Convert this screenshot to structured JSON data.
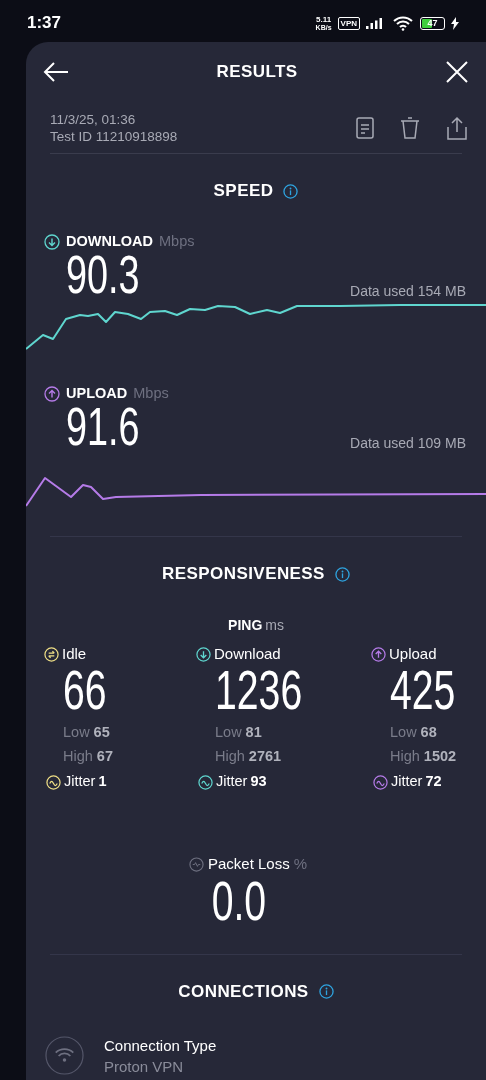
{
  "status_bar": {
    "time": "1:37",
    "net_speed": "5.11",
    "net_unit": "KB/s",
    "vpn": "VPN",
    "battery": "47",
    "charging": true
  },
  "header": {
    "title": "RESULTS"
  },
  "meta": {
    "date": "11/3/25, 01:36",
    "test_id": "Test ID 11210918898"
  },
  "speed": {
    "title": "SPEED",
    "measurements": [
      {
        "kind": "download",
        "label": "DOWNLOAD",
        "unit": "Mbps",
        "value": "90.3",
        "data_used": "Data used 154 MB"
      },
      {
        "kind": "upload",
        "label": "UPLOAD",
        "unit": "Mbps",
        "value": "91.6",
        "data_used": "Data used 109 MB"
      }
    ]
  },
  "responsiveness": {
    "title": "RESPONSIVENESS",
    "ping_label": "PING",
    "ping_unit": "ms",
    "columns": [
      {
        "kind": "idle",
        "label": "Idle",
        "value": "66",
        "low_label": "Low",
        "low": "65",
        "high_label": "High",
        "high": "67",
        "jitter_label": "Jitter",
        "jitter": "1"
      },
      {
        "kind": "download",
        "label": "Download",
        "value": "1236",
        "low_label": "Low",
        "low": "81",
        "high_label": "High",
        "high": "2761",
        "jitter_label": "Jitter",
        "jitter": "93"
      },
      {
        "kind": "upload",
        "label": "Upload",
        "value": "425",
        "low_label": "Low",
        "low": "68",
        "high_label": "High",
        "high": "1502",
        "jitter_label": "Jitter",
        "jitter": "72"
      }
    ]
  },
  "packet_loss": {
    "label": "Packet Loss",
    "unit": "%",
    "value": "0.0"
  },
  "connections": {
    "title": "CONNECTIONS",
    "items": [
      {
        "label": "Connection Type",
        "value": "Proton VPN"
      }
    ]
  }
}
